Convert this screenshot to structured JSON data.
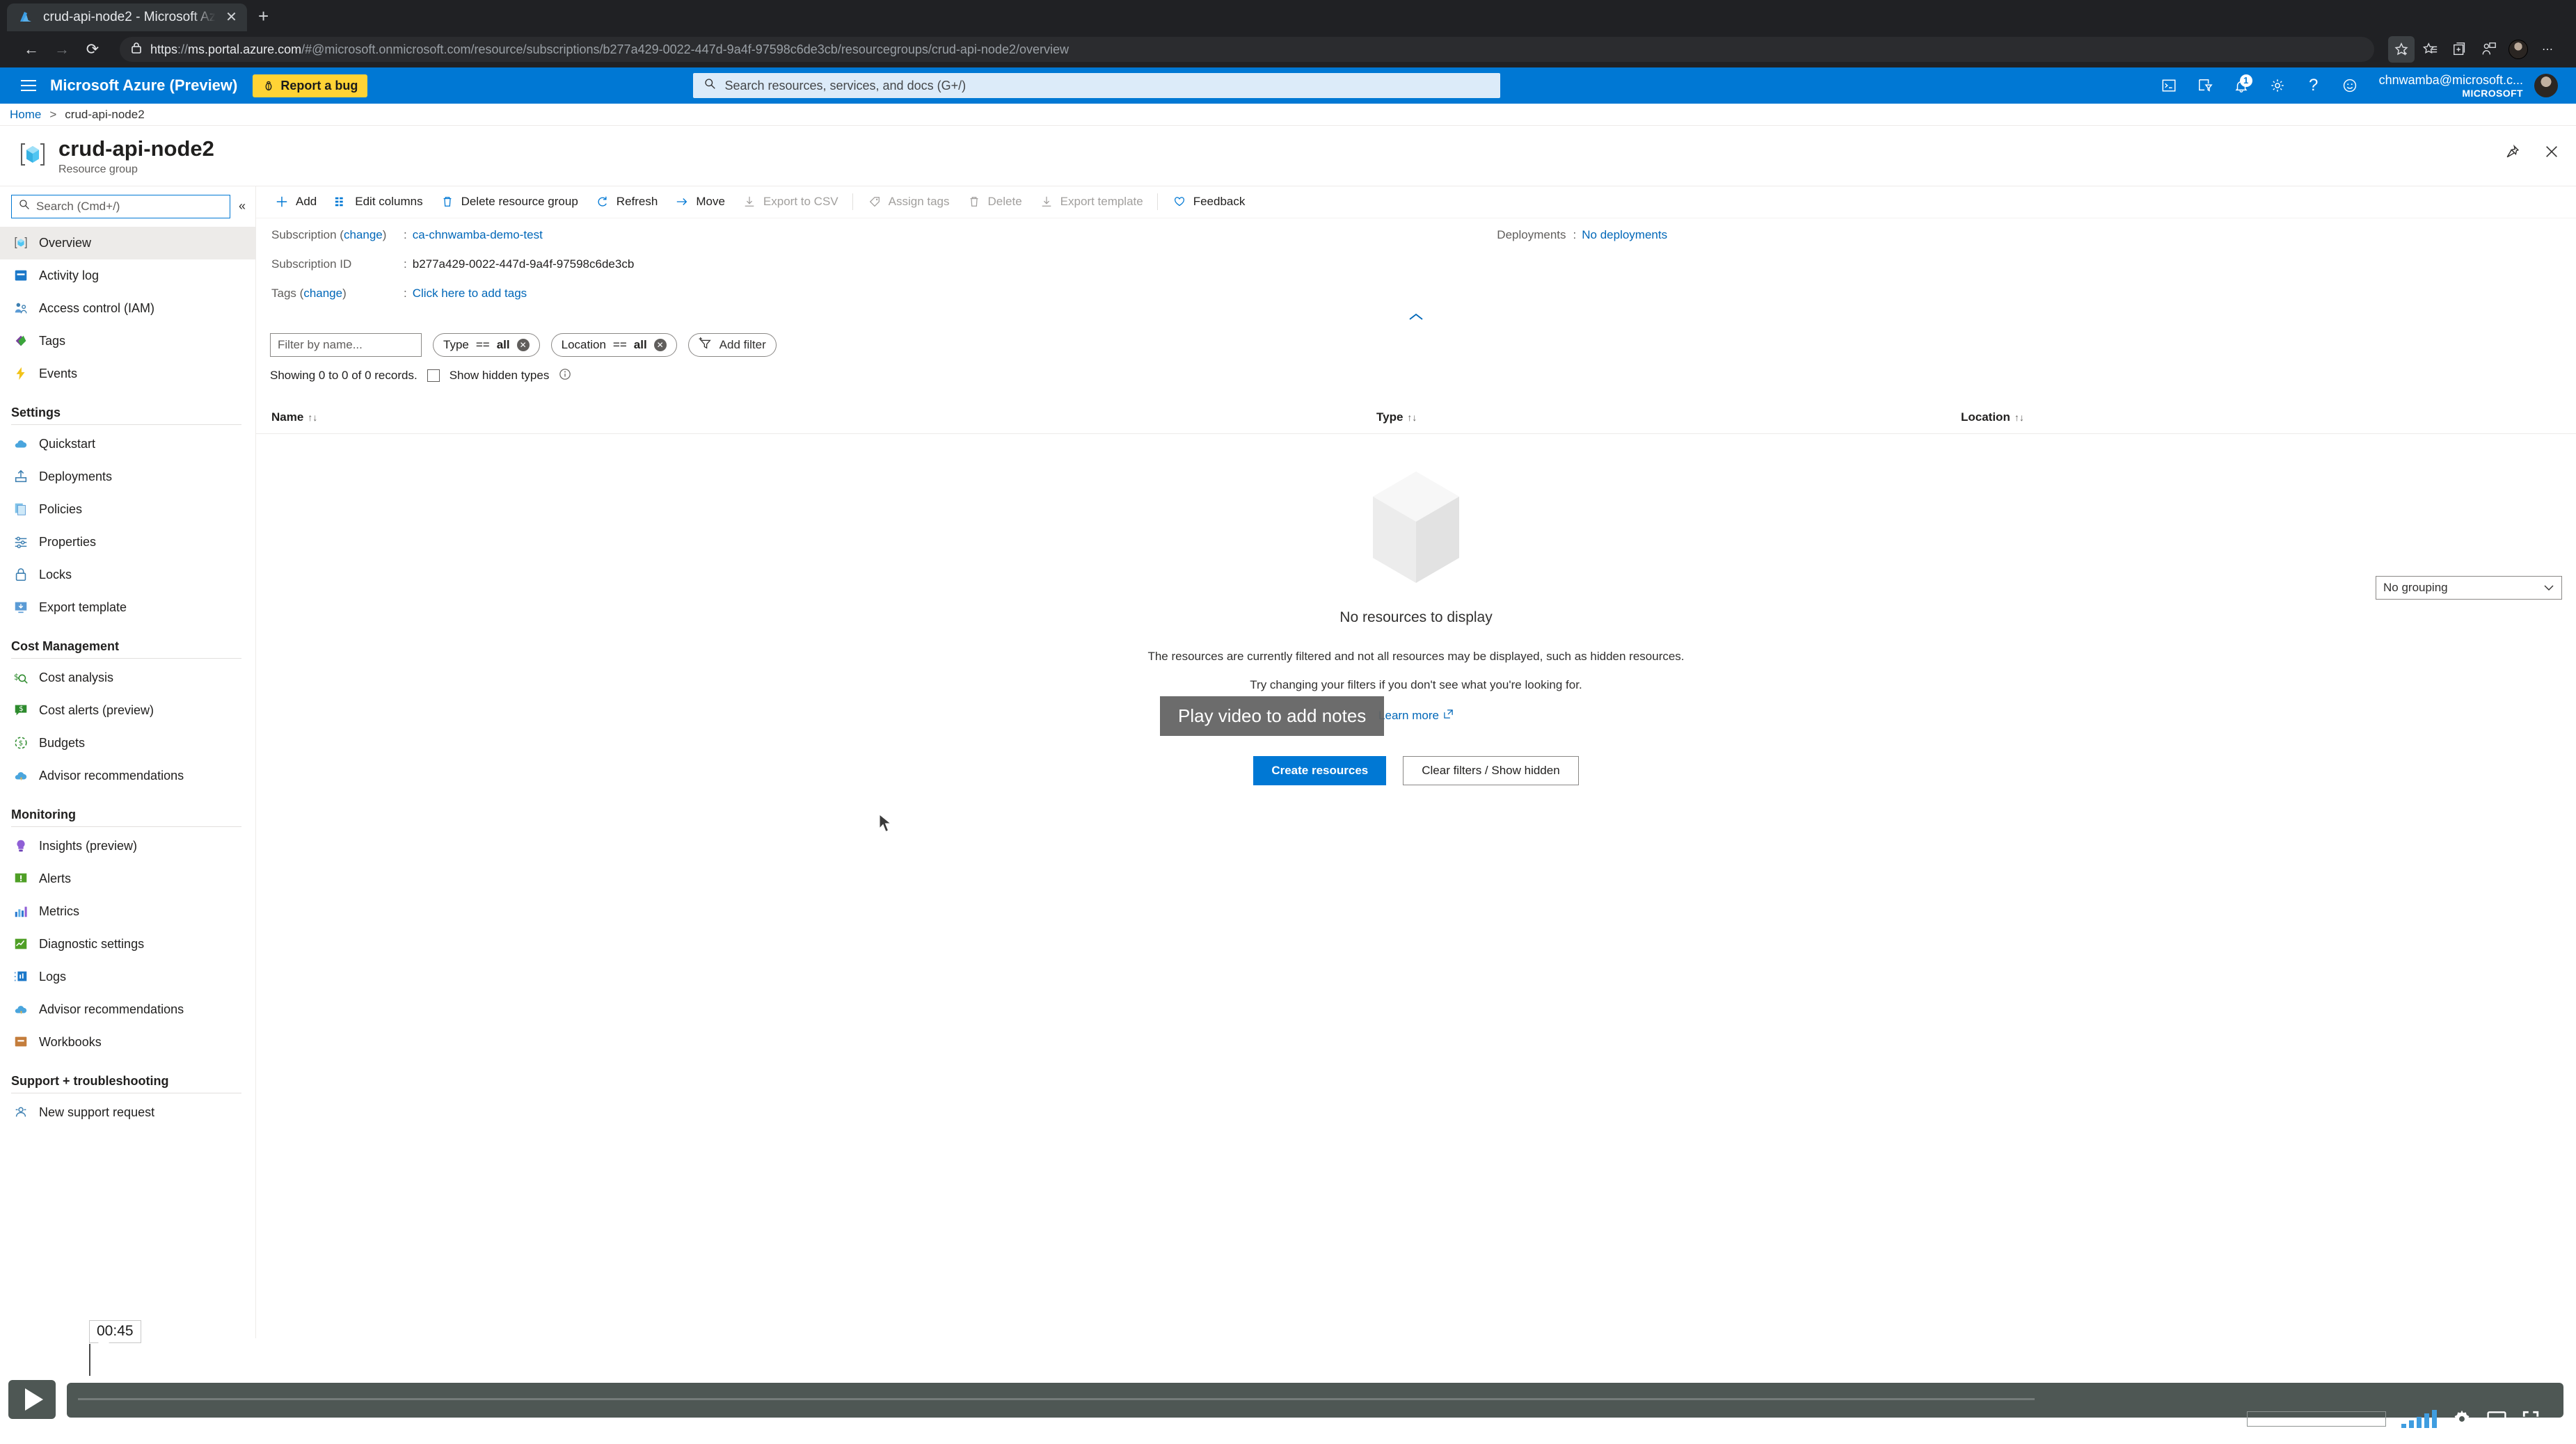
{
  "browser": {
    "tab": {
      "title": "crud-api-node2 - Microsoft Az",
      "favicon_name": "azure-favicon",
      "close_label": "✕",
      "new_tab_label": "+"
    },
    "nav": {
      "back_label": "←",
      "forward_label": "→",
      "reload_label": "⟳"
    },
    "url": {
      "scheme": "https",
      "host": "ms.portal.azure.com",
      "path": "/#@microsoft.onmicrosoft.com/resource/subscriptions/b277a429-0022-447d-9a4f-97598c6de3cb/resourcegroups/crud-api-node2/overview",
      "full": "https://ms.portal.azure.com/#@microsoft.onmicrosoft.com/resource/subscriptions/b277a429-0022-447d-9a4f-97598c6de3cb/resourcegroups/crud-api-node2/overview",
      "lock_icon": "lock-icon"
    },
    "toolbar": [
      {
        "name": "add-favorite-icon",
        "label": "☆"
      },
      {
        "name": "favorites-list-icon",
        "label": "★"
      },
      {
        "name": "collections-icon",
        "label": "⧉"
      },
      {
        "name": "profile-share-icon",
        "label": "☺"
      },
      {
        "name": "browser-profile-avatar",
        "label": ""
      },
      {
        "name": "more-options-icon",
        "label": "⋯"
      }
    ]
  },
  "azure_bar": {
    "menu_label": "menu-icon",
    "brand": "Microsoft Azure (Preview)",
    "report_bug": "Report a bug",
    "report_bug_icon": "bug-icon",
    "report_bug_color": "#ffd335",
    "search": {
      "placeholder": "Search resources, services, and docs (G+/)",
      "icon": "search-icon"
    },
    "icons": [
      {
        "name": "cloud-shell-icon",
        "glyph": "⌨"
      },
      {
        "name": "directories-filter-icon",
        "glyph": "☷"
      },
      {
        "name": "notifications-icon",
        "glyph": "🔔",
        "badge": "1"
      },
      {
        "name": "settings-gear-icon",
        "glyph": "⚙"
      },
      {
        "name": "help-icon",
        "glyph": "?"
      },
      {
        "name": "feedback-smiley-icon",
        "glyph": "☺"
      }
    ],
    "account": {
      "email": "chnwamba@microsoft.c...",
      "org": "MICROSOFT"
    },
    "brand_color": "#0078d4"
  },
  "breadcrumb": {
    "home": "Home",
    "separator": ">",
    "current": "crud-api-node2"
  },
  "page_header": {
    "icon": "resource-group-icon",
    "title": "crud-api-node2",
    "subtitle": "Resource group",
    "pin_label": "pin-icon",
    "close_label": "close-icon"
  },
  "sidebar": {
    "search_placeholder": "Search (Cmd+/)",
    "search_value": "",
    "collapse_label": "«",
    "items": [
      {
        "label": "Overview",
        "icon": "resource-group-icon",
        "selected": true
      },
      {
        "label": "Activity log",
        "icon": "activity-log-icon",
        "selected": false
      },
      {
        "label": "Access control (IAM)",
        "icon": "access-control-icon",
        "selected": false
      },
      {
        "label": "Tags",
        "icon": "tags-icon",
        "selected": false
      },
      {
        "label": "Events",
        "icon": "events-icon",
        "selected": false
      }
    ],
    "groups": [
      {
        "title": "Settings",
        "items": [
          {
            "label": "Quickstart",
            "icon": "quickstart-icon"
          },
          {
            "label": "Deployments",
            "icon": "deployments-icon"
          },
          {
            "label": "Policies",
            "icon": "policies-icon"
          },
          {
            "label": "Properties",
            "icon": "properties-icon"
          },
          {
            "label": "Locks",
            "icon": "locks-icon"
          },
          {
            "label": "Export template",
            "icon": "export-template-icon"
          }
        ]
      },
      {
        "title": "Cost Management",
        "items": [
          {
            "label": "Cost analysis",
            "icon": "cost-analysis-icon"
          },
          {
            "label": "Cost alerts (preview)",
            "icon": "cost-alerts-icon"
          },
          {
            "label": "Budgets",
            "icon": "budgets-icon"
          },
          {
            "label": "Advisor recommendations",
            "icon": "advisor-icon"
          }
        ]
      },
      {
        "title": "Monitoring",
        "items": [
          {
            "label": "Insights (preview)",
            "icon": "insights-icon"
          },
          {
            "label": "Alerts",
            "icon": "alerts-icon"
          },
          {
            "label": "Metrics",
            "icon": "metrics-icon"
          },
          {
            "label": "Diagnostic settings",
            "icon": "diagnostic-settings-icon"
          },
          {
            "label": "Logs",
            "icon": "logs-icon"
          },
          {
            "label": "Advisor recommendations",
            "icon": "advisor-icon"
          },
          {
            "label": "Workbooks",
            "icon": "workbooks-icon"
          }
        ]
      },
      {
        "title": "Support + troubleshooting",
        "items": [
          {
            "label": "New support request",
            "icon": "support-request-icon"
          }
        ]
      }
    ]
  },
  "command_bar": [
    {
      "label": "Add",
      "icon": "plus-icon",
      "disabled": false
    },
    {
      "label": "Edit columns",
      "icon": "edit-columns-icon",
      "disabled": false
    },
    {
      "label": "Delete resource group",
      "icon": "trash-icon",
      "disabled": false
    },
    {
      "label": "Refresh",
      "icon": "refresh-icon",
      "disabled": false
    },
    {
      "label": "Move",
      "icon": "move-arrow-icon",
      "disabled": false
    },
    {
      "label": "Export to CSV",
      "icon": "download-icon",
      "disabled": true
    },
    {
      "label": "Assign tags",
      "icon": "tag-icon",
      "disabled": true
    },
    {
      "label": "Delete",
      "icon": "trash-icon",
      "disabled": true
    },
    {
      "label": "Export template",
      "icon": "download-icon",
      "disabled": true
    },
    {
      "label": "Feedback",
      "icon": "heart-icon",
      "disabled": false
    }
  ],
  "essentials": {
    "subscription_label": "Subscription",
    "subscription_change": "change",
    "subscription_value": "ca-chnwamba-demo-test",
    "subscription_id_label": "Subscription ID",
    "subscription_id_value": "b277a429-0022-447d-9a4f-97598c6de3cb",
    "tags_label": "Tags",
    "tags_change": "change",
    "tags_value": "Click here to add tags",
    "deployments_label": "Deployments",
    "deployments_value": "No deployments",
    "collapse_chevron": "⌃"
  },
  "filters": {
    "name_placeholder": "Filter by name...",
    "name_value": "",
    "pills": [
      {
        "field": "Type",
        "op": "==",
        "value": "all"
      },
      {
        "field": "Location",
        "op": "==",
        "value": "all"
      }
    ],
    "add_filter": "Add filter",
    "add_filter_icon": "add-filter-icon",
    "showing_text": "Showing 0 to 0 of 0 records.",
    "show_hidden_label": "Show hidden types",
    "show_hidden_checked": false,
    "info_icon": "info-icon",
    "grouping_value": "No grouping",
    "grouping_chevron": "⌄"
  },
  "table": {
    "columns": [
      {
        "label": "Name",
        "sort": "↑↓"
      },
      {
        "label": "Type",
        "sort": "↑↓"
      },
      {
        "label": "Location",
        "sort": "↑↓"
      }
    ],
    "rows": []
  },
  "empty_state": {
    "icon": "empty-cube-icon",
    "title": "No resources to display",
    "line1": "The resources are currently filtered and not all resources may be displayed, such as hidden resources.",
    "line2": "Try changing your filters if you don't see what you're looking for.",
    "learn_more": "Learn more",
    "learn_more_icon": "external-link-icon",
    "primary_button": "Create resources",
    "secondary_button": "Clear filters / Show hidden"
  },
  "overlay_tooltip": {
    "text": "Play video to add notes"
  },
  "video_player": {
    "play_label": "play-icon",
    "time": "00:45",
    "volume_icon": "volume-bars-icon",
    "settings_icon": "gear-icon",
    "cast_icon": "cast-icon",
    "fullscreen_icon": "fullscreen-icon"
  }
}
